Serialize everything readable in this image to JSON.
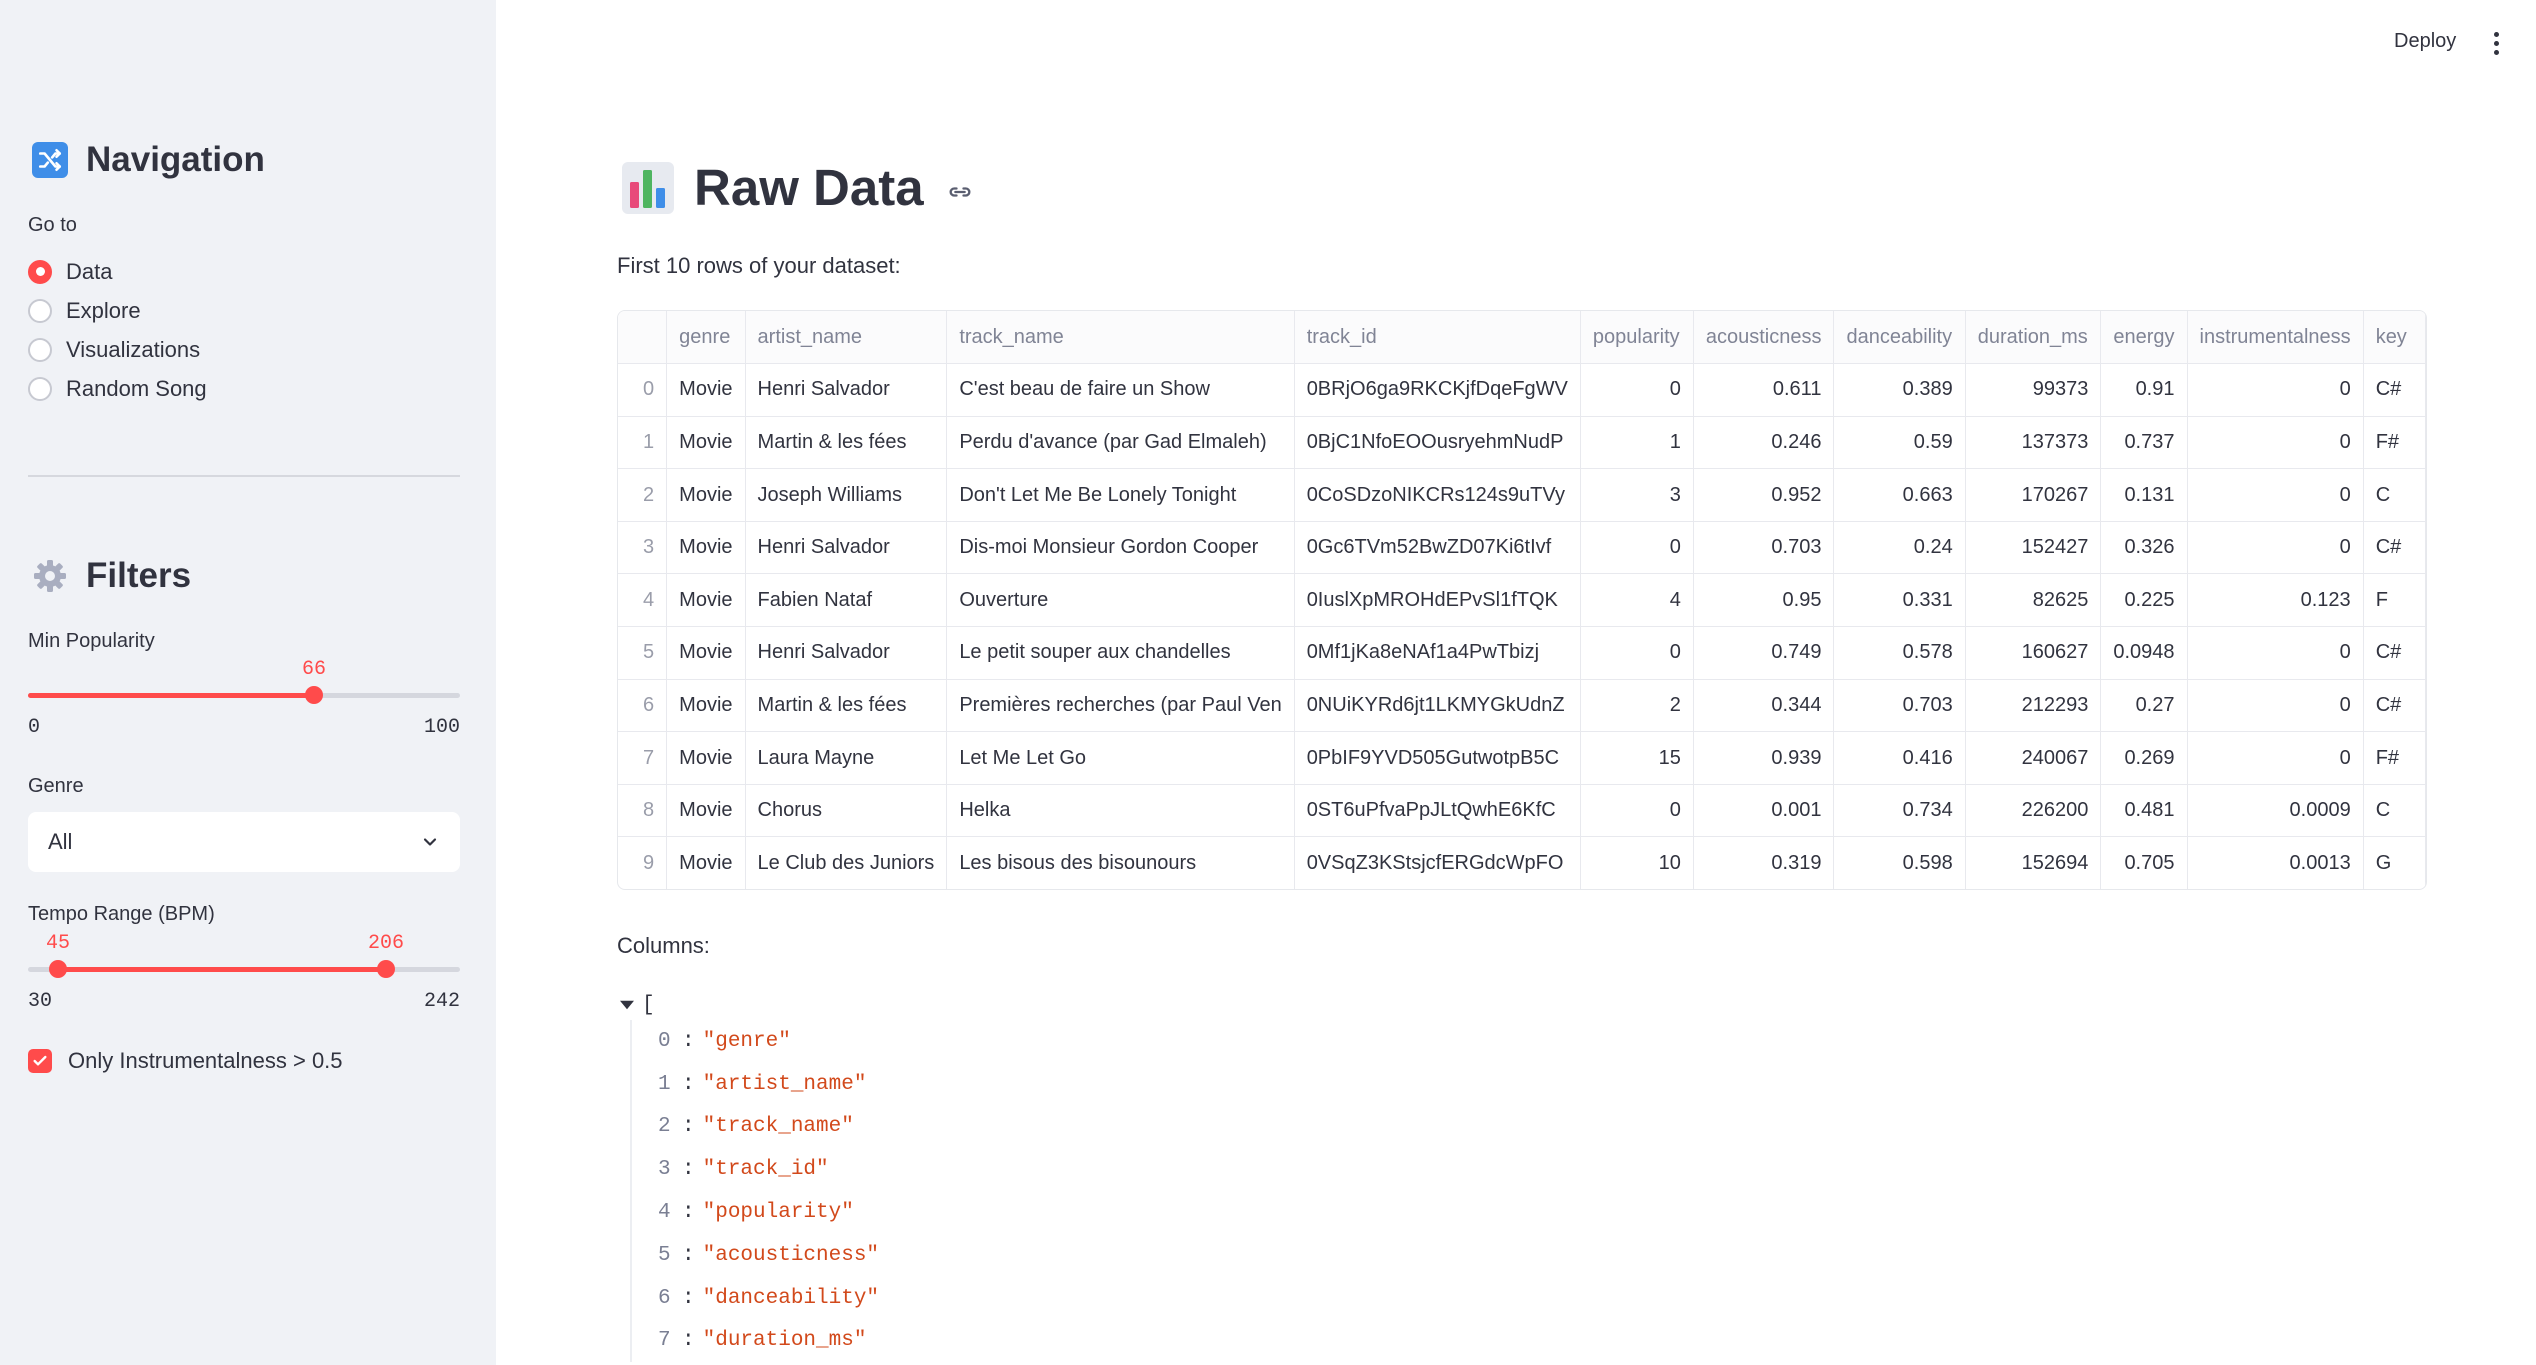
{
  "sidebar": {
    "nav_heading": "Navigation",
    "goto_label": "Go to",
    "nav_options": [
      "Data",
      "Explore",
      "Visualizations",
      "Random Song"
    ],
    "nav_selected": "Data",
    "filters_heading": "Filters",
    "min_popularity": {
      "label": "Min Popularity",
      "value": "66",
      "min": "0",
      "max": "100"
    },
    "genre": {
      "label": "Genre",
      "value": "All"
    },
    "tempo": {
      "label": "Tempo Range (BPM)",
      "low": "45",
      "high": "206",
      "min": "30",
      "max": "242"
    },
    "instrumental_checkbox": {
      "label": "Only Instrumentalness > 0.5",
      "checked": true
    }
  },
  "header": {
    "deploy_label": "Deploy"
  },
  "main": {
    "title": "Raw Data",
    "subtitle": "First 10 rows of your dataset:",
    "columns_label": "Columns:",
    "json_open": "["
  },
  "table": {
    "columns": [
      "",
      "genre",
      "artist_name",
      "track_name",
      "track_id",
      "popularity",
      "acousticness",
      "danceability",
      "duration_ms",
      "energy",
      "instrumentalness",
      "key"
    ],
    "rows": [
      [
        "0",
        "Movie",
        "Henri Salvador",
        "C'est beau de faire un Show",
        "0BRjO6ga9RKCKjfDqeFgWV",
        "0",
        "0.611",
        "0.389",
        "99373",
        "0.91",
        "0",
        "C#"
      ],
      [
        "1",
        "Movie",
        "Martin & les fées",
        "Perdu d'avance (par Gad Elmaleh)",
        "0BjC1NfoEOOusryehmNudP",
        "1",
        "0.246",
        "0.59",
        "137373",
        "0.737",
        "0",
        "F#"
      ],
      [
        "2",
        "Movie",
        "Joseph Williams",
        "Don't Let Me Be Lonely Tonight",
        "0CoSDzoNIKCRs124s9uTVy",
        "3",
        "0.952",
        "0.663",
        "170267",
        "0.131",
        "0",
        "C"
      ],
      [
        "3",
        "Movie",
        "Henri Salvador",
        "Dis-moi Monsieur Gordon Cooper",
        "0Gc6TVm52BwZD07Ki6tIvf",
        "0",
        "0.703",
        "0.24",
        "152427",
        "0.326",
        "0",
        "C#"
      ],
      [
        "4",
        "Movie",
        "Fabien Nataf",
        "Ouverture",
        "0IuslXpMROHdEPvSl1fTQK",
        "4",
        "0.95",
        "0.331",
        "82625",
        "0.225",
        "0.123",
        "F"
      ],
      [
        "5",
        "Movie",
        "Henri Salvador",
        "Le petit souper aux chandelles",
        "0Mf1jKa8eNAf1a4PwTbizj",
        "0",
        "0.749",
        "0.578",
        "160627",
        "0.0948",
        "0",
        "C#"
      ],
      [
        "6",
        "Movie",
        "Martin & les fées",
        "Premières recherches (par Paul Ven",
        "0NUiKYRd6jt1LKMYGkUdnZ",
        "2",
        "0.344",
        "0.703",
        "212293",
        "0.27",
        "0",
        "C#"
      ],
      [
        "7",
        "Movie",
        "Laura Mayne",
        "Let Me Let Go",
        "0PbIF9YVD505GutwotpB5C",
        "15",
        "0.939",
        "0.416",
        "240067",
        "0.269",
        "0",
        "F#"
      ],
      [
        "8",
        "Movie",
        "Chorus",
        "Helka",
        "0ST6uPfvaPpJLtQwhE6KfC",
        "0",
        "0.001",
        "0.734",
        "226200",
        "0.481",
        "0.0009",
        "C"
      ],
      [
        "9",
        "Movie",
        "Le Club des Juniors",
        "Les bisous des bisounours",
        "0VSqZ3KStsjcfERGdcWpFO",
        "10",
        "0.319",
        "0.598",
        "152694",
        "0.705",
        "0.0013",
        "G"
      ]
    ]
  },
  "columns_json": [
    {
      "index": "0",
      "value": "\"genre\""
    },
    {
      "index": "1",
      "value": "\"artist_name\""
    },
    {
      "index": "2",
      "value": "\"track_name\""
    },
    {
      "index": "3",
      "value": "\"track_id\""
    },
    {
      "index": "4",
      "value": "\"popularity\""
    },
    {
      "index": "5",
      "value": "\"acousticness\""
    },
    {
      "index": "6",
      "value": "\"danceability\""
    },
    {
      "index": "7",
      "value": "\"duration_ms\""
    }
  ],
  "colors": {
    "accent": "#ff4b4b",
    "sidebar_bg": "#f0f2f6",
    "text": "#31333f",
    "json_string": "#d2491b"
  },
  "icons": {
    "nav": "shuffle-icon",
    "filters": "gear-icon",
    "title": "bar-chart-icon",
    "anchor": "link-icon",
    "select": "chevron-down-icon"
  }
}
